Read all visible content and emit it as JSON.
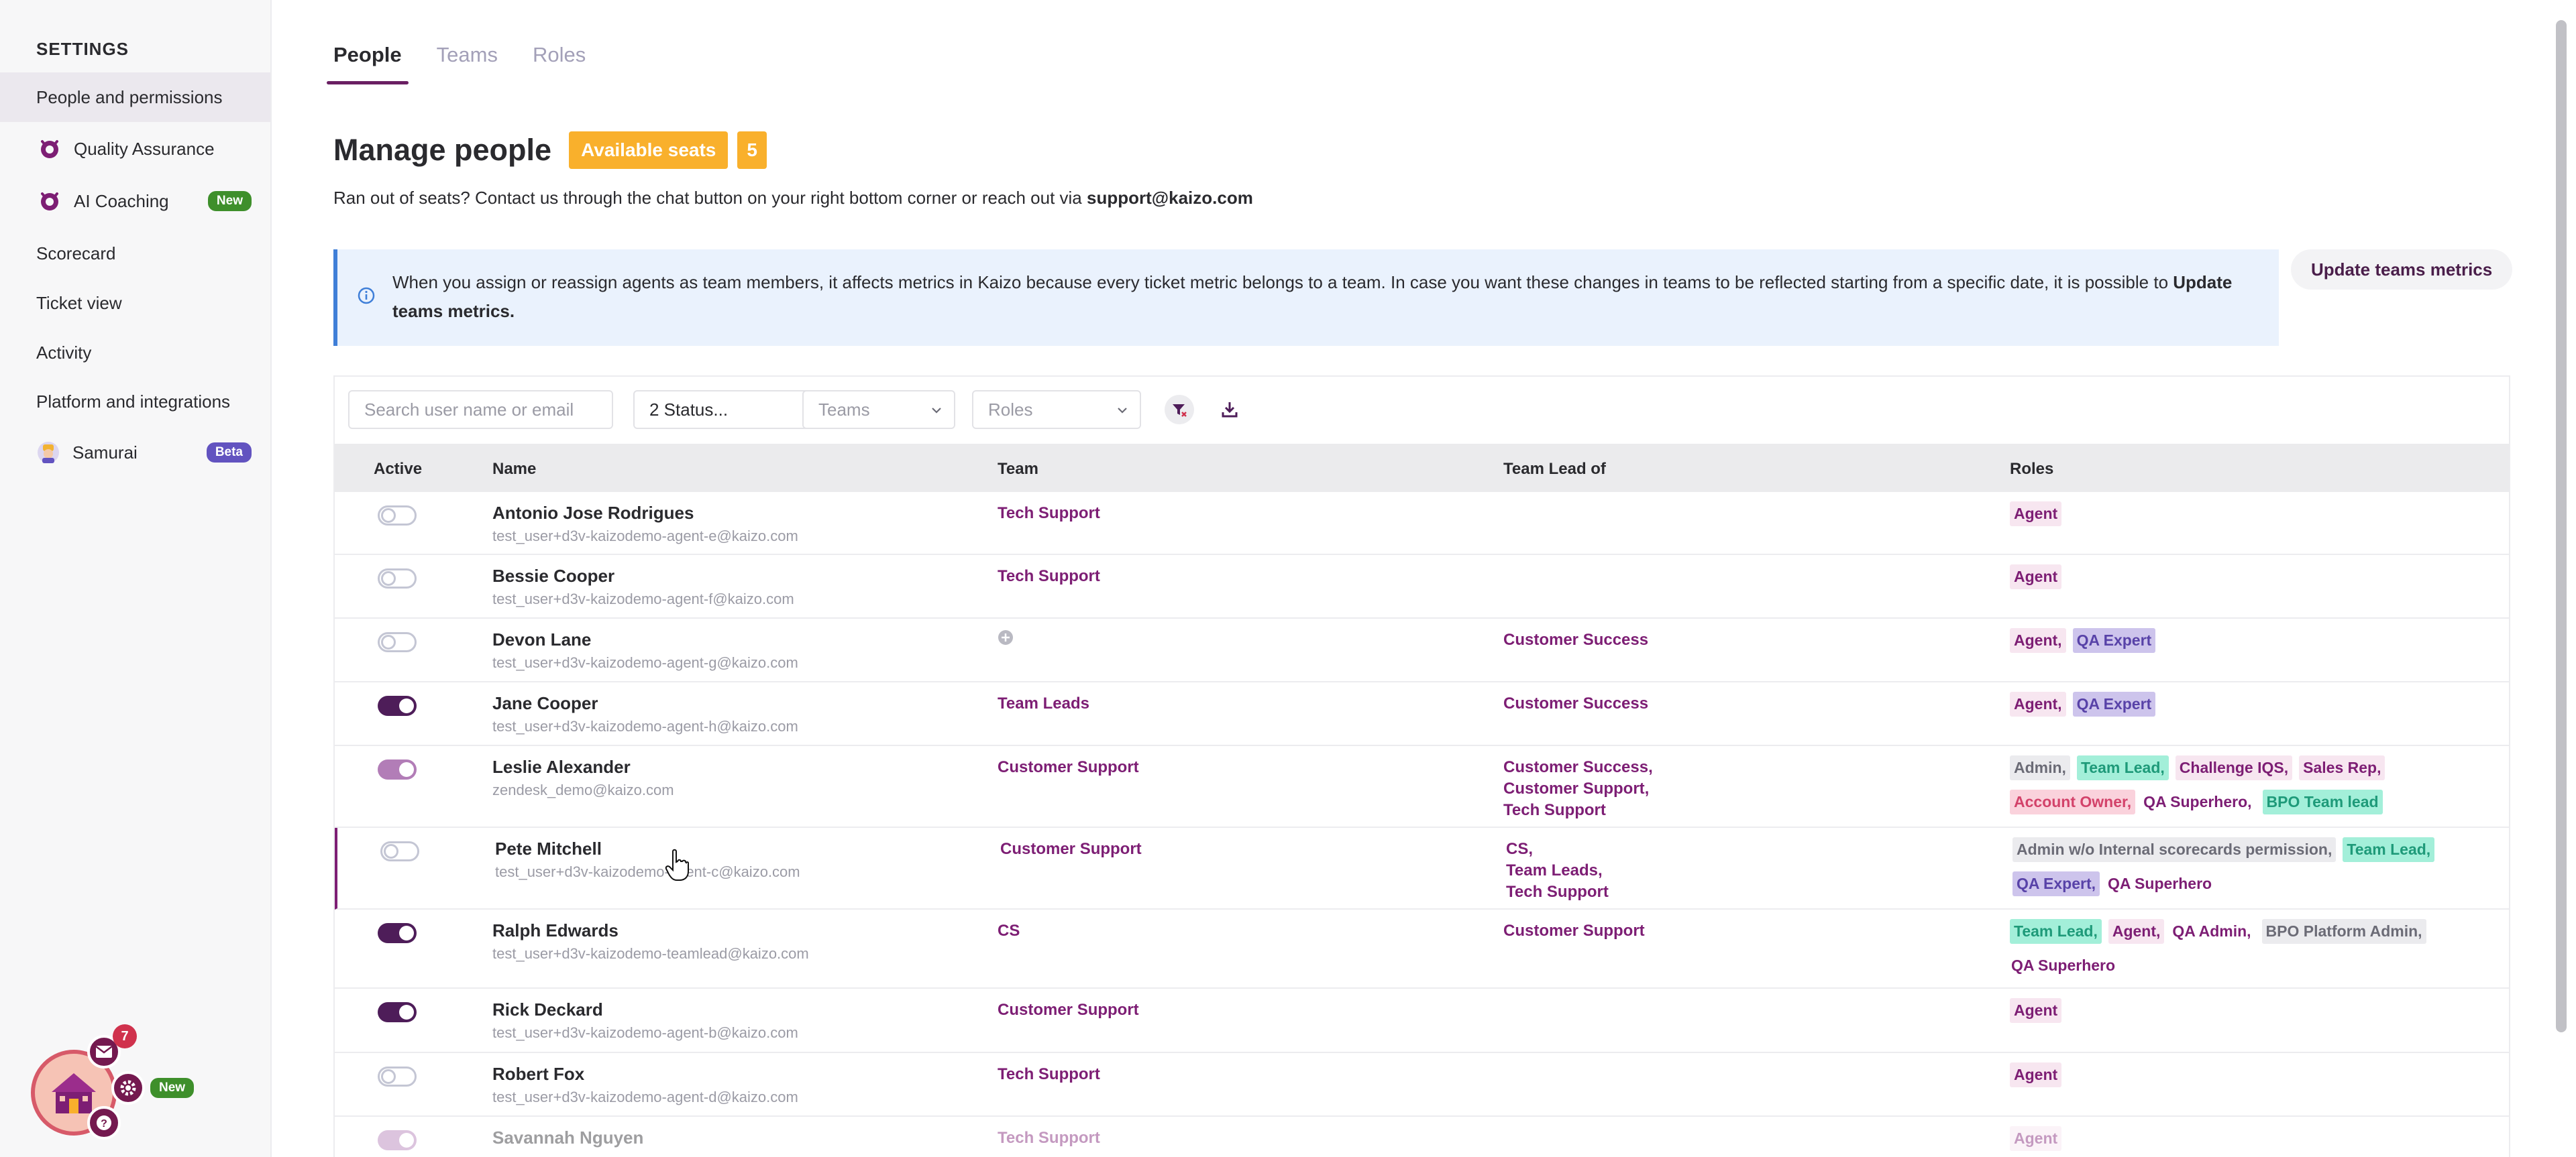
{
  "sidebar": {
    "heading": "SETTINGS",
    "items": [
      {
        "label": "People and permissions"
      },
      {
        "label": "Quality Assurance"
      },
      {
        "label": "AI Coaching",
        "badge": "New"
      },
      {
        "label": "Scorecard"
      },
      {
        "label": "Ticket view"
      },
      {
        "label": "Activity"
      },
      {
        "label": "Platform and integrations"
      },
      {
        "label": "Samurai",
        "badge": "Beta"
      }
    ]
  },
  "widget": {
    "notification_count": "7",
    "badge": "New"
  },
  "tabs": [
    {
      "label": "People"
    },
    {
      "label": "Teams"
    },
    {
      "label": "Roles"
    }
  ],
  "page": {
    "title": "Manage people",
    "seats_label": "Available seats",
    "seats_count": "5",
    "seats_note": "Ran out of seats? Contact us through the chat button on your right bottom corner or reach out via ",
    "seats_email": "support@kaizo.com"
  },
  "info": {
    "text": "When you assign or reassign agents as team members, it affects metrics in Kaizo because every ticket metric belongs to a team. In case you want these changes in teams to be reflected starting from a specific date, it is possible to ",
    "link": "Update teams metrics."
  },
  "update_button": "Update teams metrics",
  "filters": {
    "search_placeholder": "Search user name or email",
    "status_value": "2 Status...",
    "teams_placeholder": "Teams",
    "roles_placeholder": "Roles"
  },
  "table": {
    "headers": {
      "active": "Active",
      "name": "Name",
      "team": "Team",
      "lead": "Team Lead of",
      "roles": "Roles"
    },
    "rows": [
      {
        "active": "off",
        "name": "Antonio Jose Rodrigues",
        "email": "test_user+d3v-kaizodemo-agent-e@kaizo.com",
        "team": [
          "Tech Support"
        ],
        "lead": [],
        "roles": [
          [
            "Agent",
            "c-agent"
          ]
        ]
      },
      {
        "active": "off",
        "name": "Bessie Cooper",
        "email": "test_user+d3v-kaizodemo-agent-f@kaizo.com",
        "team": [
          "Tech Support"
        ],
        "lead": [],
        "roles": [
          [
            "Agent",
            "c-agent"
          ]
        ]
      },
      {
        "active": "off",
        "name": "Devon Lane",
        "email": "test_user+d3v-kaizodemo-agent-g@kaizo.com",
        "team": [],
        "lead": [
          "Customer Success"
        ],
        "roles": [
          [
            "Agent,",
            "c-agent"
          ],
          [
            "QA Expert",
            "c-qaexpert"
          ]
        ]
      },
      {
        "active": "on",
        "name": "Jane Cooper",
        "email": "test_user+d3v-kaizodemo-agent-h@kaizo.com",
        "team": [
          "Team Leads"
        ],
        "lead": [
          "Customer Success"
        ],
        "roles": [
          [
            "Agent,",
            "c-agent"
          ],
          [
            "QA Expert",
            "c-qaexpert"
          ]
        ]
      },
      {
        "active": "soft",
        "name": "Leslie Alexander",
        "email": "zendesk_demo@kaizo.com",
        "team": [
          "Customer Support"
        ],
        "lead": [
          "Customer Success,",
          "Customer Support,",
          "Tech Support"
        ],
        "roles": [
          [
            "Admin,",
            "c-admin"
          ],
          [
            "Team Lead,",
            "c-teamlead"
          ],
          [
            "Challenge IQS,",
            "c-challenge"
          ],
          [
            "Sales Rep,",
            "c-sales"
          ],
          [
            "Account Owner,",
            "c-owner"
          ],
          [
            "QA Superhero,",
            "c-plain"
          ],
          [
            "BPO Team lead",
            "c-bpo"
          ]
        ]
      },
      {
        "active": "off",
        "name": "Pete Mitchell",
        "email": "test_user+d3v-kaizodemo-agent-c@kaizo.com",
        "team": [
          "Customer Support"
        ],
        "lead": [
          "CS,",
          "Team Leads,",
          "Tech Support"
        ],
        "roles": [
          [
            "Admin w/o Internal scorecards permission,",
            "c-adminwo"
          ],
          [
            "Team Lead,",
            "c-teamlead"
          ],
          [
            "QA Expert,",
            "c-qaexpert"
          ],
          [
            "QA Superhero",
            "c-plain"
          ]
        ]
      },
      {
        "active": "on",
        "name": "Ralph Edwards",
        "email": "test_user+d3v-kaizodemo-teamlead@kaizo.com",
        "team": [
          "CS"
        ],
        "lead": [
          "Customer Support"
        ],
        "roles": [
          [
            "Team Lead,",
            "c-teamlead"
          ],
          [
            "Agent,",
            "c-agent"
          ],
          [
            "QA Admin,",
            "c-plain"
          ],
          [
            "BPO Platform Admin,",
            "c-bpoadmin"
          ],
          [
            "QA Superhero",
            "c-plain"
          ]
        ]
      },
      {
        "active": "on",
        "name": "Rick Deckard",
        "email": "test_user+d3v-kaizodemo-agent-b@kaizo.com",
        "team": [
          "Customer Support"
        ],
        "lead": [],
        "roles": [
          [
            "Agent",
            "c-agent"
          ]
        ]
      },
      {
        "active": "off",
        "name": "Robert Fox",
        "email": "test_user+d3v-kaizodemo-agent-d@kaizo.com",
        "team": [
          "Tech Support"
        ],
        "lead": [],
        "roles": [
          [
            "Agent",
            "c-agent"
          ]
        ]
      },
      {
        "active": "soft",
        "name": "Savannah Nguyen",
        "email": "",
        "team": [
          "Tech Support"
        ],
        "lead": [],
        "roles": [
          [
            "Agent",
            "c-agent"
          ]
        ]
      }
    ]
  }
}
